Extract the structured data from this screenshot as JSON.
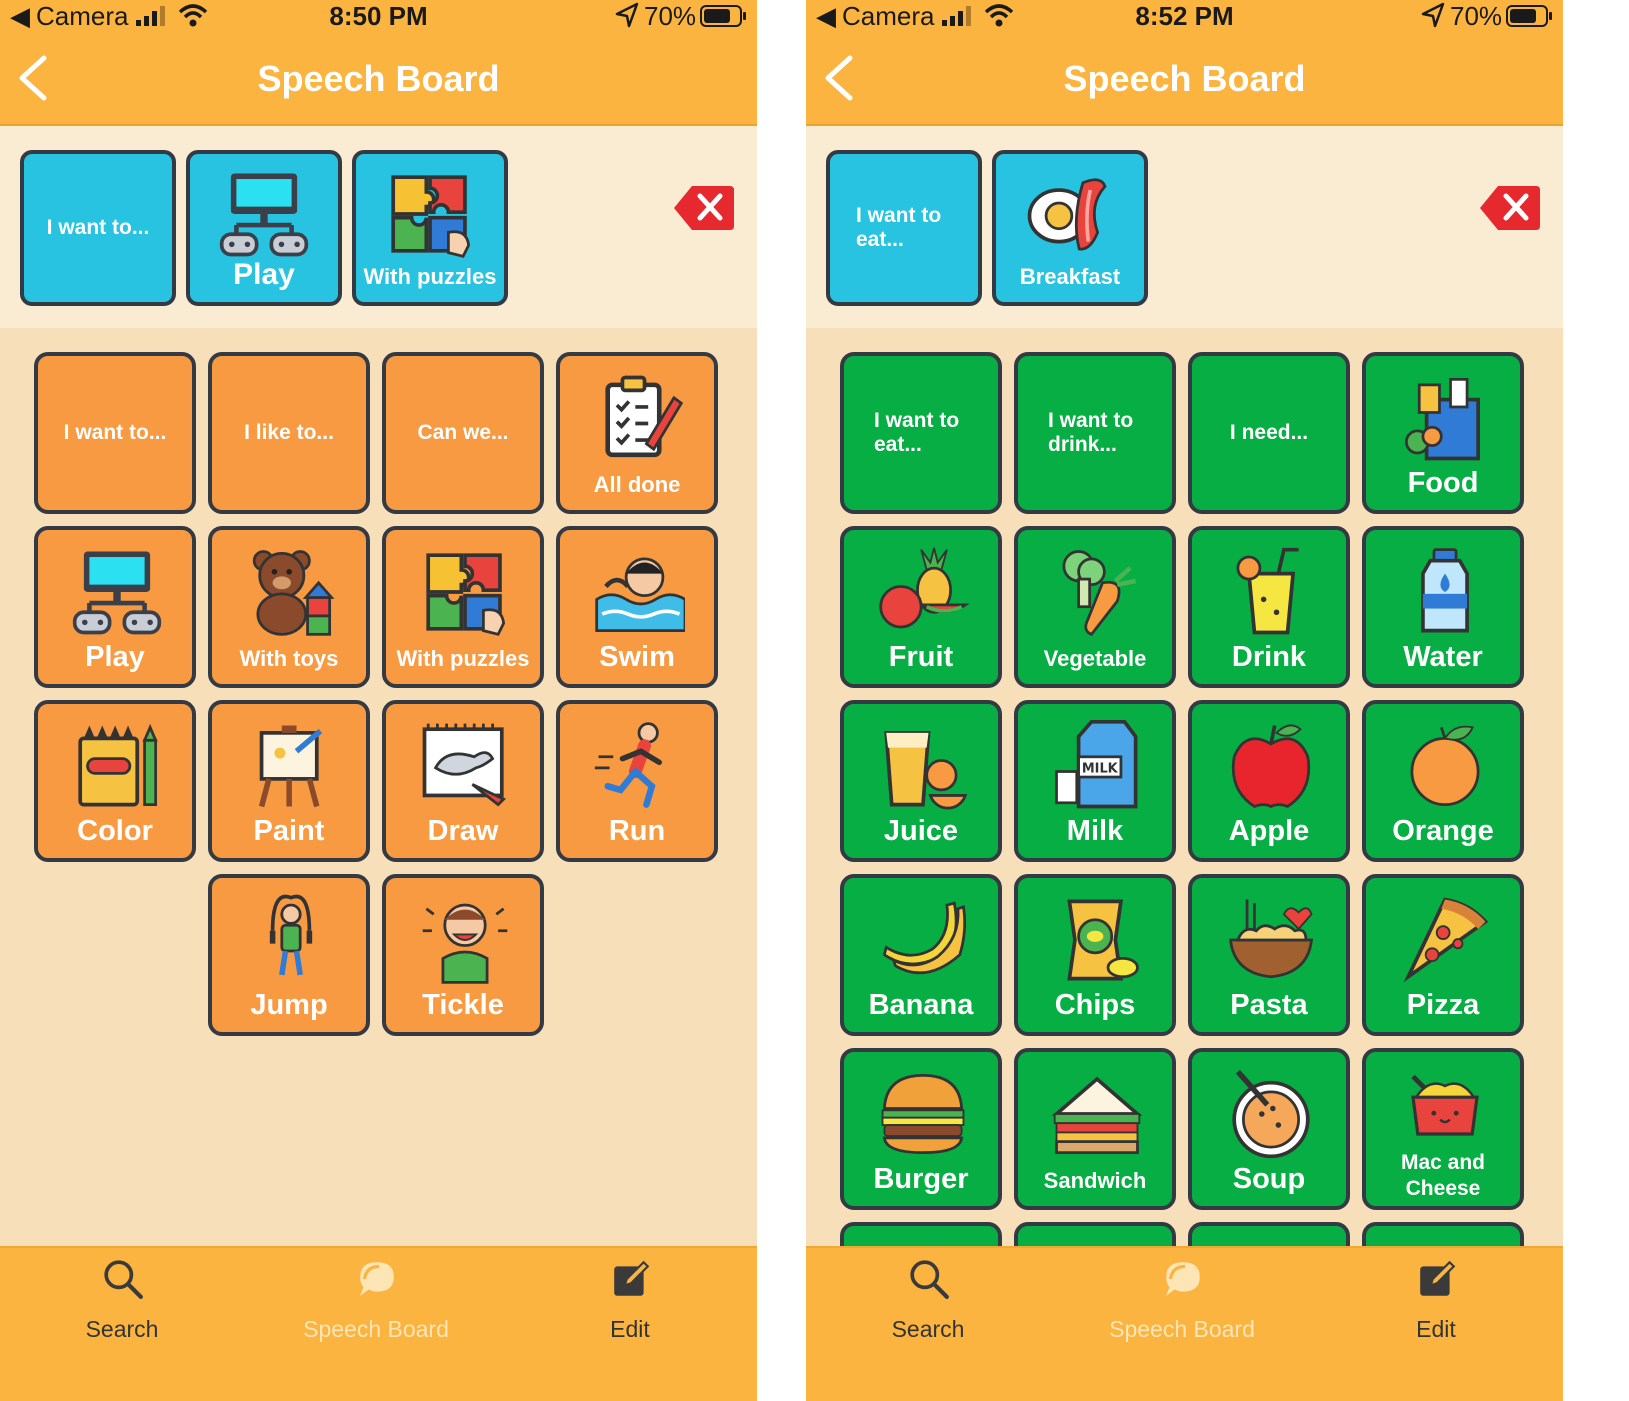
{
  "phones": [
    {
      "status": {
        "back_glyph": "◀",
        "carrier": "Camera",
        "time": "8:50 PM",
        "battery": "70%"
      },
      "nav": {
        "title": "Speech Board",
        "back_icon": "chevron-left-icon"
      },
      "sentence_strip": [
        {
          "label": "I want to...",
          "icon": ""
        },
        {
          "label": "Play",
          "icon": "game-console-icon"
        },
        {
          "label": "With puzzles",
          "icon": "puzzle-icon"
        }
      ],
      "clear_icon": "clear-delete-icon",
      "tile_color": "#f89a42",
      "tiles": [
        {
          "label": "I want to...",
          "icon": ""
        },
        {
          "label": "I like to...",
          "icon": ""
        },
        {
          "label": "Can we...",
          "icon": ""
        },
        {
          "label": "All done",
          "icon": "clipboard-check-icon"
        },
        {
          "label": "Play",
          "icon": "game-console-icon"
        },
        {
          "label": "With toys",
          "icon": "teddy-bear-icon"
        },
        {
          "label": "With puzzles",
          "icon": "puzzle-icon"
        },
        {
          "label": "Swim",
          "icon": "swimmer-icon"
        },
        {
          "label": "Color",
          "icon": "crayons-icon"
        },
        {
          "label": "Paint",
          "icon": "easel-icon"
        },
        {
          "label": "Draw",
          "icon": "sketchbook-icon"
        },
        {
          "label": "Run",
          "icon": "runner-icon"
        },
        {
          "label": "Jump",
          "icon": "jump-rope-icon"
        },
        {
          "label": "Tickle",
          "icon": "laughing-kid-icon"
        }
      ],
      "tabs": [
        {
          "label": "Search",
          "icon": "search-icon",
          "active": false
        },
        {
          "label": "Speech Board",
          "icon": "speech-bubble-icon",
          "active": true
        },
        {
          "label": "Edit",
          "icon": "edit-icon",
          "active": false
        }
      ]
    },
    {
      "status": {
        "back_glyph": "◀",
        "carrier": "Camera",
        "time": "8:52 PM",
        "battery": "70%"
      },
      "nav": {
        "title": "Speech Board",
        "back_icon": "chevron-left-icon"
      },
      "sentence_strip": [
        {
          "label": "I want to eat...",
          "icon": ""
        },
        {
          "label": "Breakfast",
          "icon": "breakfast-icon"
        }
      ],
      "clear_icon": "clear-delete-icon",
      "tile_color": "#07ae44",
      "tiles": [
        {
          "label": "I want to eat...",
          "icon": ""
        },
        {
          "label": "I want to drink...",
          "icon": ""
        },
        {
          "label": "I need...",
          "icon": ""
        },
        {
          "label": "Food",
          "icon": "groceries-icon"
        },
        {
          "label": "Fruit",
          "icon": "fruit-icon"
        },
        {
          "label": "Vegetable",
          "icon": "vegetable-icon"
        },
        {
          "label": "Drink",
          "icon": "drink-glass-icon"
        },
        {
          "label": "Water",
          "icon": "water-bottle-icon"
        },
        {
          "label": "Juice",
          "icon": "juice-icon"
        },
        {
          "label": "Milk",
          "icon": "milk-carton-icon"
        },
        {
          "label": "Apple",
          "icon": "apple-icon"
        },
        {
          "label": "Orange",
          "icon": "orange-icon"
        },
        {
          "label": "Banana",
          "icon": "banana-icon"
        },
        {
          "label": "Chips",
          "icon": "chips-icon"
        },
        {
          "label": "Pasta",
          "icon": "pasta-icon"
        },
        {
          "label": "Pizza",
          "icon": "pizza-icon"
        },
        {
          "label": "Burger",
          "icon": "burger-icon"
        },
        {
          "label": "Sandwich",
          "icon": "sandwich-icon"
        },
        {
          "label": "Soup",
          "icon": "soup-icon"
        },
        {
          "label": "Mac and Cheese",
          "icon": "mac-and-cheese-icon"
        }
      ],
      "tabs": [
        {
          "label": "Search",
          "icon": "search-icon",
          "active": false
        },
        {
          "label": "Speech Board",
          "icon": "speech-bubble-icon",
          "active": true
        },
        {
          "label": "Edit",
          "icon": "edit-icon",
          "active": false
        }
      ]
    }
  ]
}
